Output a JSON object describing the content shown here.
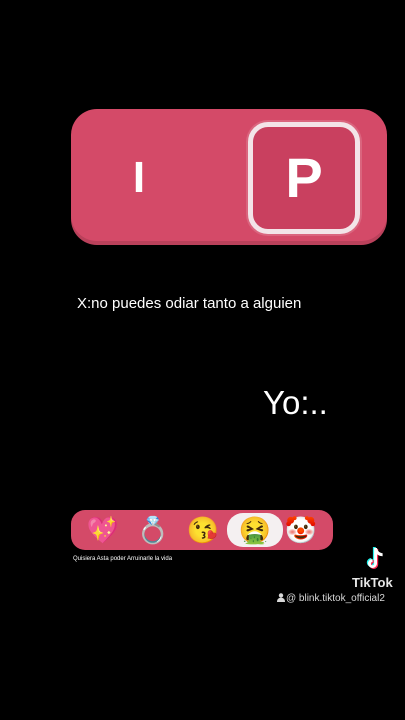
{
  "toggle": {
    "left_label": "I",
    "knob_label": "P",
    "color": "#d44a68"
  },
  "caption": "X:no puedes odiar tanto a alguien",
  "reply": "Yo:..",
  "reactions": [
    {
      "icon": "sparkling-heart-icon",
      "glyph": "💖"
    },
    {
      "icon": "ring-icon",
      "glyph": "💍"
    },
    {
      "icon": "face-blowing-kiss-icon",
      "glyph": "😘"
    },
    {
      "icon": "face-vomiting-icon",
      "glyph": "🤮",
      "selected": true
    },
    {
      "icon": "clown-face-icon",
      "glyph": "🤡"
    }
  ],
  "small_text": "Quisiera Asta poder Arruinarle la vida",
  "watermark": {
    "brand": "TikTok",
    "handle": "@ blink.tiktok_official2"
  }
}
